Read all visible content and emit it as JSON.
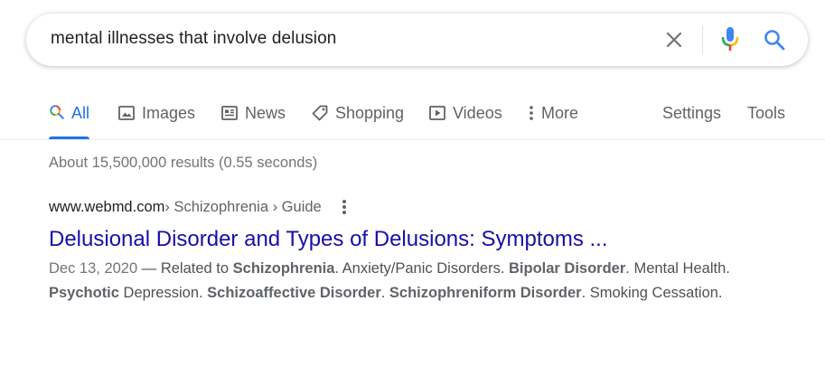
{
  "search": {
    "query": "mental illnesses that involve delusion"
  },
  "icons": {
    "clear": "close-icon",
    "mic": "microphone-icon",
    "search": "magnifier-icon"
  },
  "colors": {
    "accent_blue": "#1a73e8",
    "link_title": "#1a0dab",
    "mic_blue": "#4285f4",
    "mic_red": "#ea4335",
    "mic_yellow": "#fbbc05",
    "mic_green": "#34a853"
  },
  "tabs": {
    "all": "All",
    "images": "Images",
    "news": "News",
    "shopping": "Shopping",
    "videos": "Videos",
    "more": "More",
    "settings": "Settings",
    "tools": "Tools"
  },
  "results_stats": "About 15,500,000 results (0.55 seconds)",
  "result": {
    "domain": "www.webmd.com",
    "breadcrumb": " › Schizophrenia › Guide",
    "title": "Delusional Disorder and Types of Delusions: Symptoms ...",
    "date": "Dec 13, 2020",
    "snippet": [
      {
        "t": " — Related to ",
        "b": false
      },
      {
        "t": "Schizophrenia",
        "b": true
      },
      {
        "t": ". Anxiety/Panic Disorders. ",
        "b": false
      },
      {
        "t": "Bipolar Disorder",
        "b": true
      },
      {
        "t": ". Mental Health. ",
        "b": false
      },
      {
        "t": "Psychotic",
        "b": true
      },
      {
        "t": " Depression. ",
        "b": false
      },
      {
        "t": "Schizoaffective Disorder",
        "b": true
      },
      {
        "t": ". ",
        "b": false
      },
      {
        "t": "Schizophreniform Disorder",
        "b": true
      },
      {
        "t": ". Smoking Cessation.",
        "b": false
      }
    ]
  }
}
